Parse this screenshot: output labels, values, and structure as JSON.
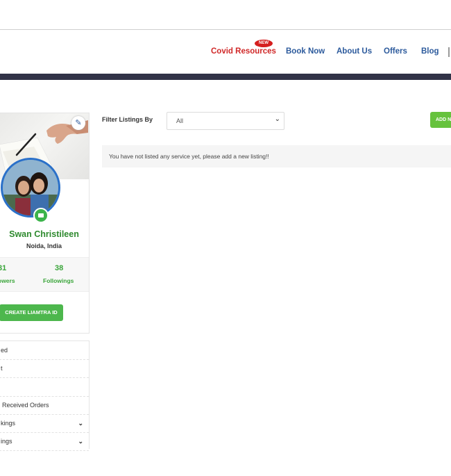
{
  "nav": {
    "new_badge": "NEW",
    "items": [
      {
        "label": "Covid Resources"
      },
      {
        "label": "Book Now"
      },
      {
        "label": "About Us"
      },
      {
        "label": "Offers"
      },
      {
        "label": "Blog"
      }
    ]
  },
  "profile": {
    "name": "Swan Christileen",
    "location": "Noida, India",
    "followers_count": "31",
    "followers_label": "owers",
    "followings_count": "38",
    "followings_label": "Followings",
    "create_button": "CREATE LIAMTRA ID"
  },
  "sidebar": {
    "items": [
      {
        "label": "ed"
      },
      {
        "label": "t"
      },
      {
        "label": ""
      },
      {
        "label": "Received Orders"
      },
      {
        "label": "kings"
      },
      {
        "label": "ings"
      }
    ]
  },
  "filter": {
    "label": "Filter Listings By",
    "selected": "All",
    "add_button": "ADD N"
  },
  "notice": {
    "text": "You have not listed any service yet, please add a new listing!!"
  },
  "colors": {
    "accent_green": "#4db74d",
    "nav_blue": "#2c5a9c",
    "covid_red": "#d02828",
    "dark_bar": "#313347"
  }
}
